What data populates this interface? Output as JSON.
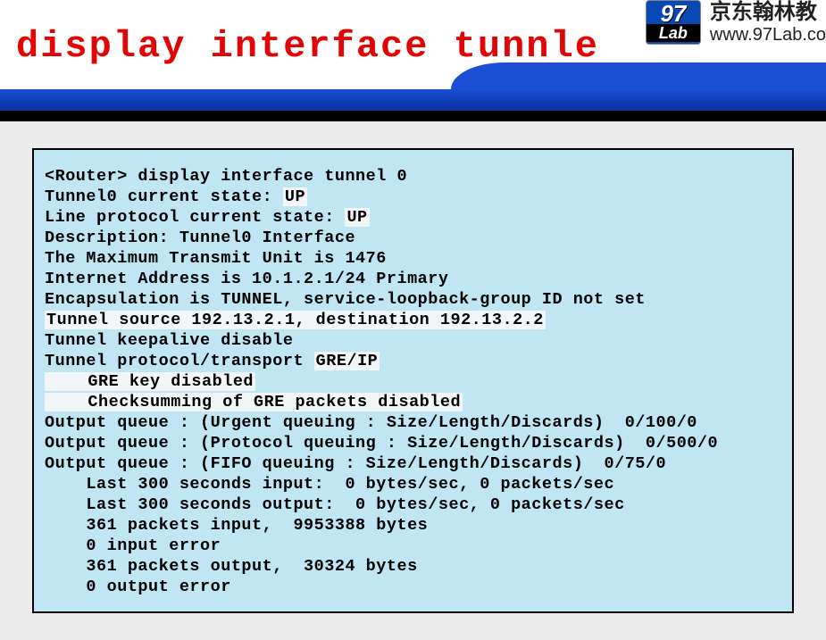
{
  "title": "display interface tunnle",
  "logo": {
    "top": "97",
    "bottom": "Lab"
  },
  "brand": {
    "cn": "京东翰林教",
    "url": "www.97Lab.co"
  },
  "term": {
    "l1": "<Router> display interface tunnel 0",
    "l2a": "Tunnel0 current state: ",
    "l2b": "UP",
    "l3a": "Line protocol current state: ",
    "l3b": "UP",
    "l4": "Description: Tunnel0 Interface",
    "l5": "The Maximum Transmit Unit is 1476",
    "l6": "Internet Address is 10.1.2.1/24 Primary",
    "l7": "Encapsulation is TUNNEL, service-loopback-group ID not set",
    "l8": "Tunnel source 192.13.2.1, destination 192.13.2.2",
    "l9": "Tunnel keepalive disable",
    "l10a": "Tunnel protocol/transport ",
    "l10b": "GRE/IP",
    "l11": "    GRE key disabled",
    "l12": "    Checksumming of GRE packets disabled",
    "l13": "Output queue : (Urgent queuing : Size/Length/Discards)  0/100/0",
    "l14": "Output queue : (Protocol queuing : Size/Length/Discards)  0/500/0",
    "l15": "Output queue : (FIFO queuing : Size/Length/Discards)  0/75/0",
    "l16": "    Last 300 seconds input:  0 bytes/sec, 0 packets/sec",
    "l17": "    Last 300 seconds output:  0 bytes/sec, 0 packets/sec",
    "l18": "    361 packets input,  9953388 bytes",
    "l19": "    0 input error",
    "l20": "    361 packets output,  30324 bytes",
    "l21": "    0 output error"
  }
}
